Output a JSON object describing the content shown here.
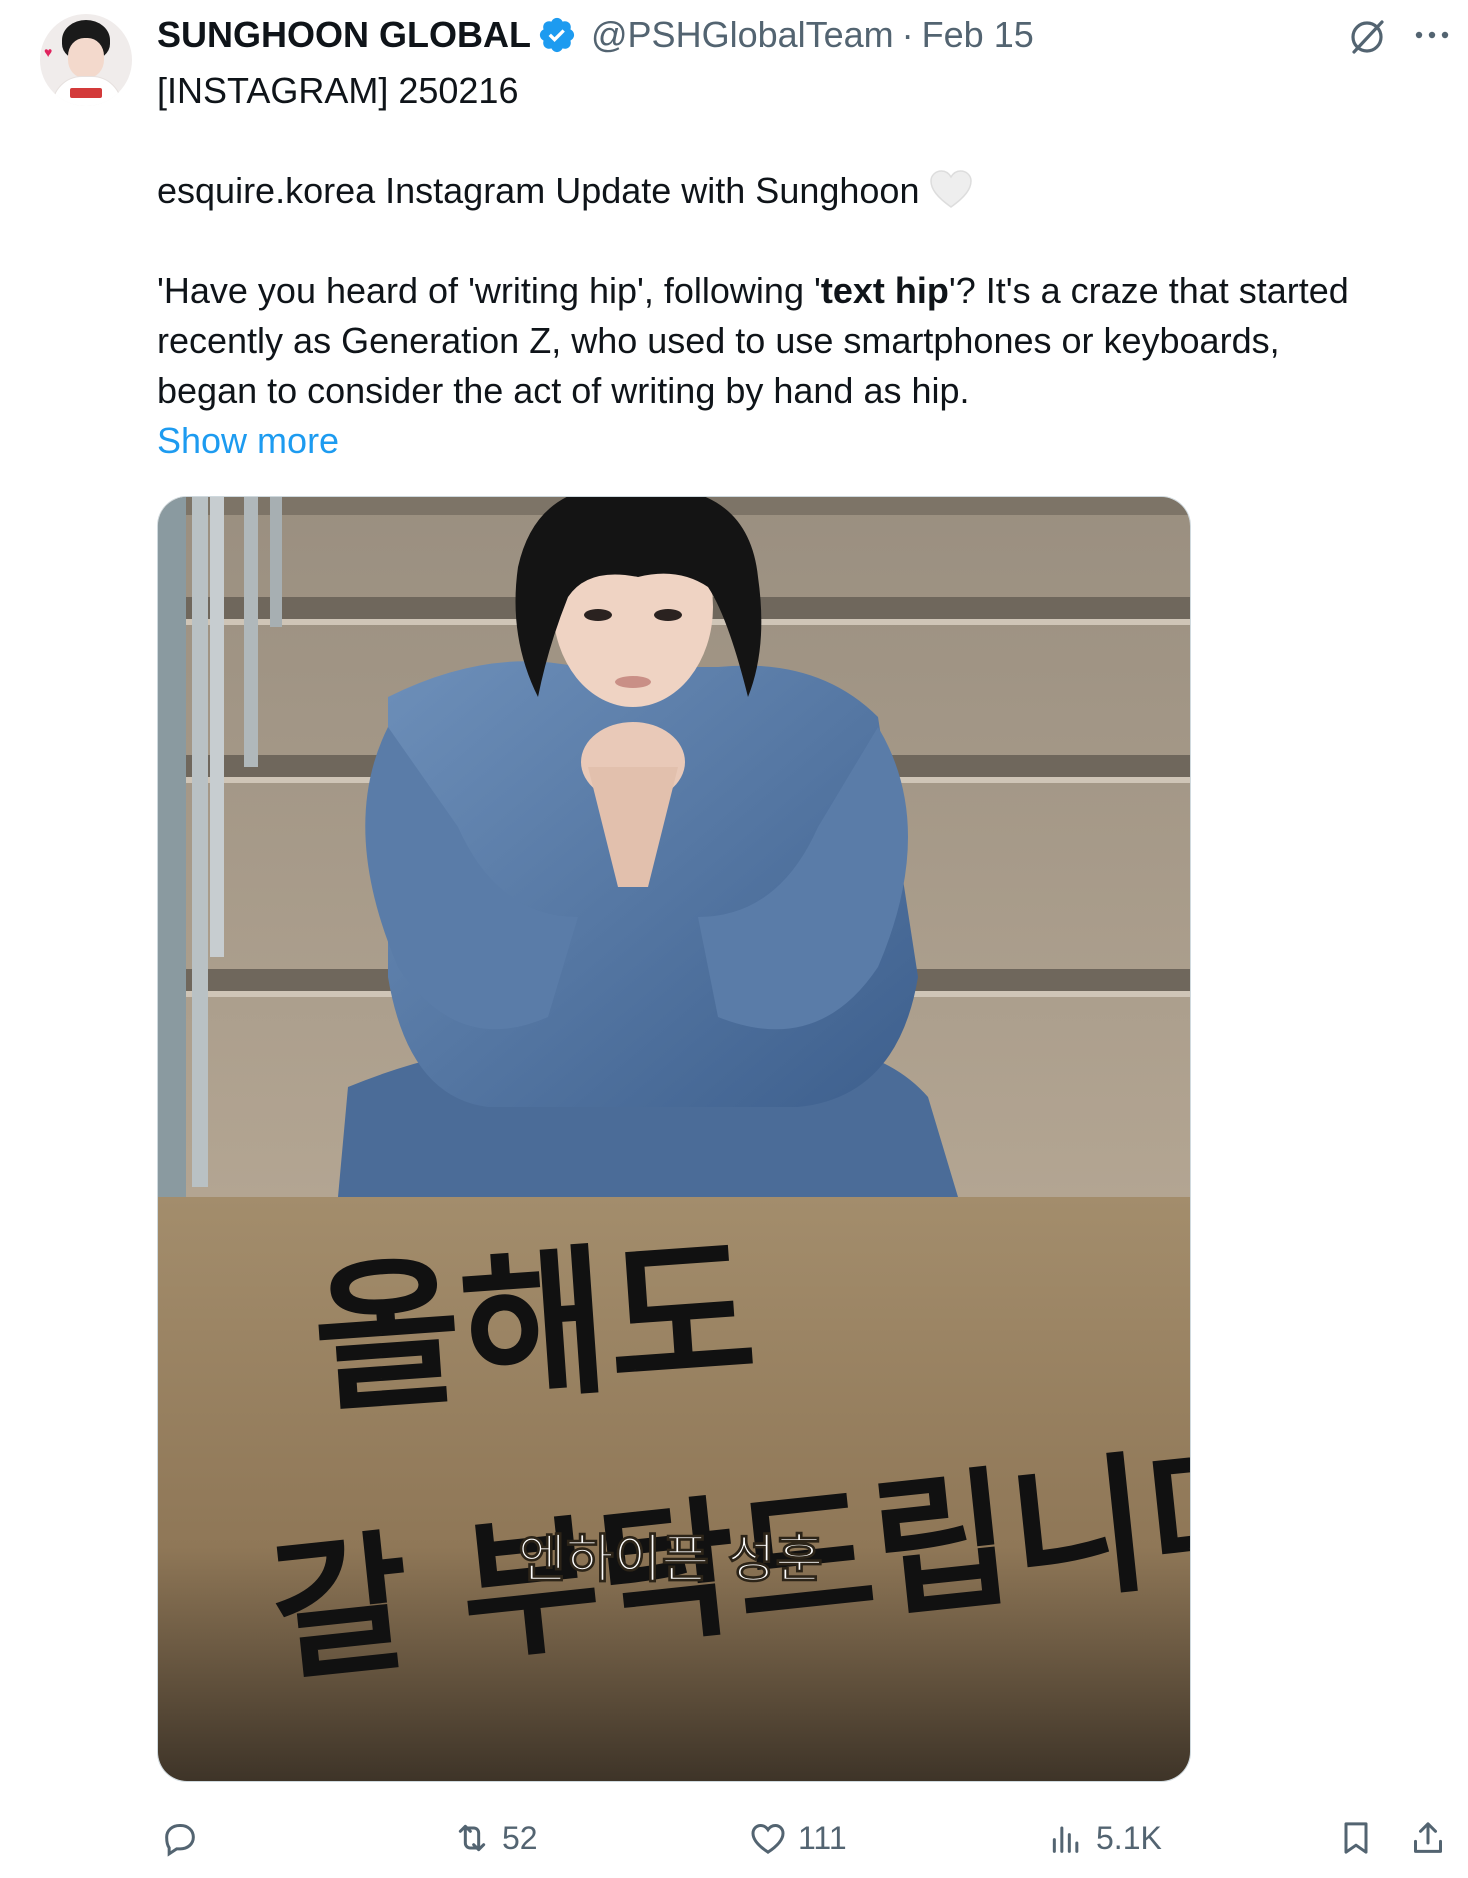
{
  "tweet": {
    "author_name": "SUNGHOON GLOBAL",
    "handle": "@PSHGlobalTeam",
    "separator": "·",
    "date": "Feb 15",
    "line1": "[INSTAGRAM] 250216",
    "line2": "esquire.korea Instagram Update with Sunghoon",
    "body_part1": "'Have you heard of 'writing hip', following '",
    "body_bold": "text hip",
    "body_part2": "'? It's a craze that started",
    "body_line2": "recently as Generation Z, who used to use smartphones or keyboards,",
    "body_line3": "began to consider the act of writing by hand as hip.",
    "show_more": "Show more"
  },
  "media": {
    "calligraphy_line1": "올해도",
    "calligraphy_line2": "갈 부탁드립니다",
    "caption": "엔하이픈 성훈"
  },
  "actions": {
    "reply_count": "",
    "retweet_count": "52",
    "like_count": "111",
    "views_count": "5.1K"
  },
  "icons": {
    "verified": "verified-badge-icon",
    "grok": "grok-icon",
    "more": "more-icon",
    "reply": "reply-icon",
    "retweet": "retweet-icon",
    "like": "heart-icon",
    "views": "views-icon",
    "bookmark": "bookmark-icon",
    "share": "share-icon"
  },
  "colors": {
    "verified_blue": "#1d9bf0",
    "link_blue": "#1d9bf0",
    "muted": "#536471",
    "text": "#0f1419"
  }
}
